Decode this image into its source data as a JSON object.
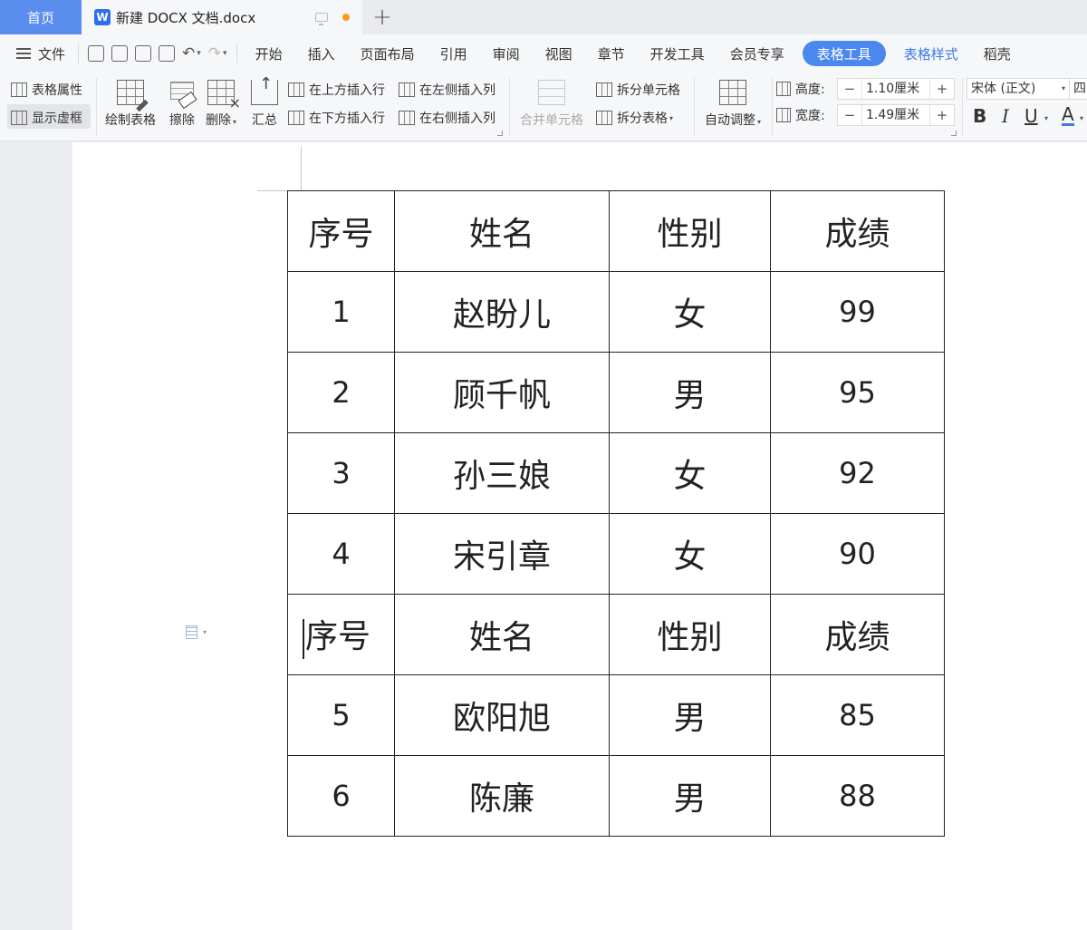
{
  "tabs": {
    "home": "首页",
    "doc_icon": "W",
    "doc_title": "新建 DOCX 文档.docx",
    "add": "+"
  },
  "menu": {
    "file": "文件",
    "items": [
      "开始",
      "插入",
      "页面布局",
      "引用",
      "审阅",
      "视图",
      "章节",
      "开发工具",
      "会员专享",
      "表格工具",
      "表格样式",
      "稻壳"
    ],
    "active": "表格工具"
  },
  "ribbon": {
    "table_props": "表格属性",
    "show_gridlines": "显示虚框",
    "draw_table": "绘制表格",
    "erase": "擦除",
    "delete": "删除",
    "summary": "汇总",
    "insert_above": "在上方插入行",
    "insert_below": "在下方插入行",
    "insert_left": "在左侧插入列",
    "insert_right": "在右侧插入列",
    "merge_cells": "合并单元格",
    "split_cells": "拆分单元格",
    "split_table": "拆分表格",
    "auto_fit": "自动调整",
    "height_label": "高度:",
    "height_value": "1.10厘米",
    "width_label": "宽度:",
    "width_value": "1.49厘米",
    "minus": "−",
    "plus": "+",
    "font_name": "宋体 (正文)",
    "font_size": "四",
    "bold": "B",
    "italic": "I",
    "underline": "U",
    "font_color": "A"
  },
  "table": {
    "rows": [
      [
        "序号",
        "姓名",
        "性别",
        "成绩"
      ],
      [
        "1",
        "赵盼儿",
        "女",
        "99"
      ],
      [
        "2",
        "顾千帆",
        "男",
        "95"
      ],
      [
        "3",
        "孙三娘",
        "女",
        "92"
      ],
      [
        "4",
        "宋引章",
        "女",
        "90"
      ],
      [
        "序号",
        "姓名",
        "性别",
        "成绩"
      ],
      [
        "5",
        "欧阳旭",
        "男",
        "85"
      ],
      [
        "6",
        "陈廉",
        "男",
        "88"
      ]
    ]
  },
  "colors": {
    "accent": "#4a88f0",
    "home_tab": "#5b8def",
    "modified_dot": "#f0a020"
  }
}
